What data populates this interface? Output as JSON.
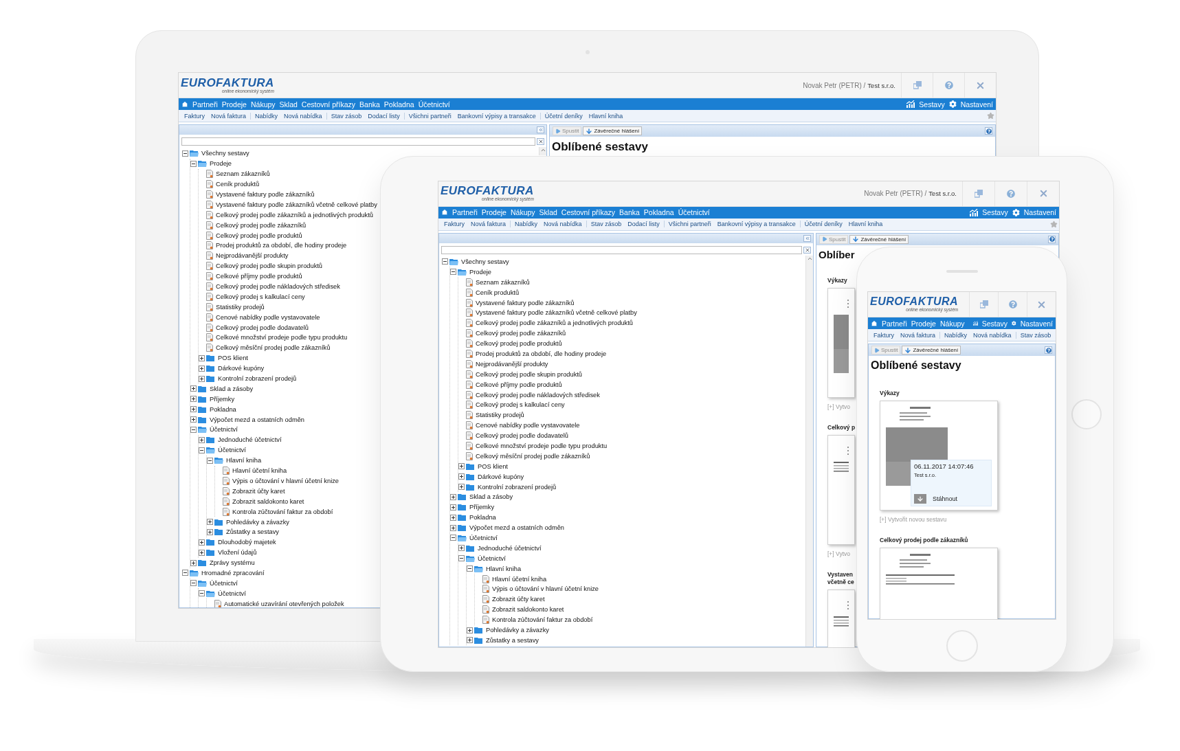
{
  "laptop": {
    "logo": {
      "wordmark": "EUROFAKTURA",
      "tagline": "online ekonomický systém"
    },
    "user": {
      "name": "Novak Petr (PETR) /",
      "company": "Test s.r.o."
    },
    "menu": [
      "Partneři",
      "Prodeje",
      "Nákupy",
      "Sklad",
      "Cestovní příkazy",
      "Banka",
      "Pokladna",
      "Účetnictví"
    ],
    "menu_right": [
      {
        "label": "Sestavy",
        "kind": "reports"
      },
      {
        "label": "Nastavení",
        "kind": "settings"
      }
    ],
    "toolbar_groups": [
      [
        "Faktury",
        "Nová faktura"
      ],
      [
        "Nabídky",
        "Nová nabídka"
      ],
      [
        "Stav zásob",
        "Dodací listy"
      ],
      [
        "Všichni partneři",
        "Bankovní výpisy a transakce"
      ],
      [
        "Účetní deníky",
        "Hlavní kniha"
      ]
    ],
    "actions": [
      {
        "label": "Spustit",
        "disabled": true
      },
      {
        "label": "Závěrečné hlášení",
        "disabled": false
      }
    ],
    "title": "Oblíbené sestavy",
    "tree": [
      {
        "label": "Všechny sestavy",
        "kind": "folder",
        "expanded": true,
        "children": [
          {
            "label": "Prodeje",
            "kind": "folder",
            "expanded": true,
            "children": [
              {
                "label": "Seznam zákazníků",
                "kind": "report"
              },
              {
                "label": "Ceník produktů",
                "kind": "report"
              },
              {
                "label": "Vystavené faktury podle zákazníků",
                "kind": "report"
              },
              {
                "label": "Vystavené faktury podle zákazníků včetně celkové platby",
                "kind": "report"
              },
              {
                "label": "Celkový prodej podle zákazníků a jednotlivých produktů",
                "kind": "report"
              },
              {
                "label": "Celkový prodej podle zákazníků",
                "kind": "report"
              },
              {
                "label": "Celkový prodej podle produktů",
                "kind": "report"
              },
              {
                "label": "Prodej produktů za období, dle hodiny prodeje",
                "kind": "report"
              },
              {
                "label": "Nejprodávanější produkty",
                "kind": "report"
              },
              {
                "label": "Celkový prodej podle skupin produktů",
                "kind": "report"
              },
              {
                "label": "Celkové příjmy podle produktů",
                "kind": "report"
              },
              {
                "label": "Celkový prodej podle nákladových středisek",
                "kind": "report"
              },
              {
                "label": "Celkový prodej s kalkulací ceny",
                "kind": "report"
              },
              {
                "label": "Statistiky prodejů",
                "kind": "report"
              },
              {
                "label": "Cenové nabídky podle vystavovatele",
                "kind": "report"
              },
              {
                "label": "Celkový prodej podle dodavatelů",
                "kind": "report"
              },
              {
                "label": "Celkové množství prodeje podle typu produktu",
                "kind": "report"
              },
              {
                "label": "Celkový měsíční prodej podle zákazníků",
                "kind": "report"
              },
              {
                "label": "POS klient",
                "kind": "folder",
                "expanded": false
              },
              {
                "label": "Dárkové kupóny",
                "kind": "folder",
                "expanded": false
              },
              {
                "label": "Kontrolní zobrazení prodejů",
                "kind": "folder",
                "expanded": false
              }
            ]
          },
          {
            "label": "Sklad a zásoby",
            "kind": "folder",
            "expanded": false
          },
          {
            "label": "Příjemky",
            "kind": "folder",
            "expanded": false
          },
          {
            "label": "Pokladna",
            "kind": "folder",
            "expanded": false
          },
          {
            "label": "Výpočet mezd a ostatních odměn",
            "kind": "folder",
            "expanded": false
          },
          {
            "label": "Účetnictví",
            "kind": "folder",
            "expanded": true,
            "children": [
              {
                "label": "Jednoduché účetnictví",
                "kind": "folder",
                "expanded": false
              },
              {
                "label": "Účetnictví",
                "kind": "folder",
                "expanded": true,
                "children": [
                  {
                    "label": "Hlavní kniha",
                    "kind": "folder",
                    "expanded": true,
                    "children": [
                      {
                        "label": "Hlavní účetní kniha",
                        "kind": "report"
                      },
                      {
                        "label": "Výpis o účtování v hlavní účetní knize",
                        "kind": "report"
                      },
                      {
                        "label": "Zobrazit účty karet",
                        "kind": "report"
                      },
                      {
                        "label": "Zobrazit saldokonto karet",
                        "kind": "report"
                      },
                      {
                        "label": "Kontrola zúčtování faktur za období",
                        "kind": "report"
                      }
                    ]
                  },
                  {
                    "label": "Pohledávky a závazky",
                    "kind": "folder",
                    "expanded": false
                  },
                  {
                    "label": "Zůstatky a sestavy",
                    "kind": "folder",
                    "expanded": false
                  }
                ]
              },
              {
                "label": "Dlouhodobý majetek",
                "kind": "folder",
                "expanded": false
              },
              {
                "label": "Vložení údajů",
                "kind": "folder",
                "expanded": false
              }
            ]
          },
          {
            "label": "Zprávy systému",
            "kind": "folder",
            "expanded": false
          }
        ]
      },
      {
        "label": "Hromadné zpracování",
        "kind": "folder",
        "expanded": true,
        "children": [
          {
            "label": "Účetnictví",
            "kind": "folder",
            "expanded": true,
            "children": [
              {
                "label": "Účetnictví",
                "kind": "folder",
                "expanded": true,
                "children": [
                  {
                    "label": "Automatické uzavírání otevřených položek",
                    "kind": "report"
                  }
                ]
              }
            ]
          }
        ]
      }
    ]
  },
  "tablet": {
    "logo": {
      "wordmark": "EUROFAKTURA",
      "tagline": "online ekonomický systém"
    },
    "user": {
      "name": "Novak Petr (PETR) /",
      "company": "Test s.r.o."
    },
    "menu": [
      "Partneři",
      "Prodeje",
      "Nákupy",
      "Sklad",
      "Cestovní příkazy",
      "Banka",
      "Pokladna",
      "Účetnictví"
    ],
    "menu_right": [
      {
        "label": "Sestavy",
        "kind": "reports"
      },
      {
        "label": "Nastavení",
        "kind": "settings"
      }
    ],
    "toolbar_groups": [
      [
        "Faktury",
        "Nová faktura"
      ],
      [
        "Nabídky",
        "Nová nabídka"
      ],
      [
        "Stav zásob",
        "Dodací listy"
      ],
      [
        "Všichni partneři",
        "Bankovní výpisy a transakce"
      ],
      [
        "Účetní deníky",
        "Hlavní kniha"
      ]
    ],
    "actions": [
      {
        "label": "Spustit",
        "disabled": true
      },
      {
        "label": "Závěrečné hlášení",
        "disabled": false
      }
    ],
    "title": "Oblíber",
    "sections": [
      {
        "title_lines": [
          "Výkazy"
        ],
        "create": "[+] Vytvo"
      },
      {
        "title_lines": [
          "Celkový p"
        ],
        "create": "[+] Vytvo"
      },
      {
        "title_lines": [
          "Vystaven",
          "včetně ce"
        ]
      }
    ],
    "tree": [
      {
        "label": "Všechny sestavy",
        "kind": "folder",
        "expanded": true,
        "children": [
          {
            "label": "Prodeje",
            "kind": "folder",
            "expanded": true,
            "children": [
              {
                "label": "Seznam zákazníků",
                "kind": "report"
              },
              {
                "label": "Ceník produktů",
                "kind": "report"
              },
              {
                "label": "Vystavené faktury podle zákazníků",
                "kind": "report"
              },
              {
                "label": "Vystavené faktury podle zákazníků včetně celkové platby",
                "kind": "report"
              },
              {
                "label": "Celkový prodej podle zákazníků a jednotlivých produktů",
                "kind": "report"
              },
              {
                "label": "Celkový prodej podle zákazníků",
                "kind": "report"
              },
              {
                "label": "Celkový prodej podle produktů",
                "kind": "report"
              },
              {
                "label": "Prodej produktů za období, dle hodiny prodeje",
                "kind": "report"
              },
              {
                "label": "Nejprodávanější produkty",
                "kind": "report"
              },
              {
                "label": "Celkový prodej podle skupin produktů",
                "kind": "report"
              },
              {
                "label": "Celkové příjmy podle produktů",
                "kind": "report"
              },
              {
                "label": "Celkový prodej podle nákladových středisek",
                "kind": "report"
              },
              {
                "label": "Celkový prodej s kalkulací ceny",
                "kind": "report"
              },
              {
                "label": "Statistiky prodejů",
                "kind": "report"
              },
              {
                "label": "Cenové nabídky podle vystavovatele",
                "kind": "report"
              },
              {
                "label": "Celkový prodej podle dodavatelů",
                "kind": "report"
              },
              {
                "label": "Celkové množství prodeje podle typu produktu",
                "kind": "report"
              },
              {
                "label": "Celkový měsíční prodej podle zákazníků",
                "kind": "report"
              },
              {
                "label": "POS klient",
                "kind": "folder",
                "expanded": false
              },
              {
                "label": "Dárkové kupóny",
                "kind": "folder",
                "expanded": false
              },
              {
                "label": "Kontrolní zobrazení prodejů",
                "kind": "folder",
                "expanded": false
              }
            ]
          },
          {
            "label": "Sklad a zásoby",
            "kind": "folder",
            "expanded": false
          },
          {
            "label": "Příjemky",
            "kind": "folder",
            "expanded": false
          },
          {
            "label": "Pokladna",
            "kind": "folder",
            "expanded": false
          },
          {
            "label": "Výpočet mezd a ostatních odměn",
            "kind": "folder",
            "expanded": false
          },
          {
            "label": "Účetnictví",
            "kind": "folder",
            "expanded": true,
            "children": [
              {
                "label": "Jednoduché účetnictví",
                "kind": "folder",
                "expanded": false
              },
              {
                "label": "Účetnictví",
                "kind": "folder",
                "expanded": true,
                "children": [
                  {
                    "label": "Hlavní kniha",
                    "kind": "folder",
                    "expanded": true,
                    "children": [
                      {
                        "label": "Hlavní účetní kniha",
                        "kind": "report"
                      },
                      {
                        "label": "Výpis o účtování v hlavní účetní knize",
                        "kind": "report"
                      },
                      {
                        "label": "Zobrazit účty karet",
                        "kind": "report"
                      },
                      {
                        "label": "Zobrazit saldokonto karet",
                        "kind": "report"
                      },
                      {
                        "label": "Kontrola zúčtování faktur za období",
                        "kind": "report"
                      }
                    ]
                  },
                  {
                    "label": "Pohledávky a závazky",
                    "kind": "folder",
                    "expanded": false
                  },
                  {
                    "label": "Zůstatky a sestavy",
                    "kind": "folder",
                    "expanded": false
                  }
                ]
              }
            ]
          }
        ]
      }
    ]
  },
  "phone": {
    "logo": {
      "wordmark": "EUROFAKTURA",
      "tagline": "online ekonomický systém"
    },
    "menu": [
      "Partneři",
      "Prodeje",
      "Nákupy"
    ],
    "menu_right": [
      {
        "label": "Sestavy",
        "kind": "reports"
      },
      {
        "label": "Nastavení",
        "kind": "settings"
      }
    ],
    "toolbar_groups": [
      [
        "Faktury",
        "Nová faktura"
      ],
      [
        "Nabídky",
        "Nová nabídka"
      ],
      [
        "Stav zásob"
      ]
    ],
    "actions": [
      {
        "label": "Spustit",
        "disabled": true
      },
      {
        "label": "Závěrečné hlášení",
        "disabled": false
      }
    ],
    "title": "Oblíbené sestavy",
    "sections": [
      {
        "title_lines": [
          "Výkazy"
        ],
        "card": {
          "date": "06.11.2017 14:07:46",
          "company": "Test s.r.o.",
          "download": "Stáhnout"
        },
        "create": "[+] Vytvořit novou sestavu"
      },
      {
        "title_lines": [
          "Celkový prodej podle zákazníků"
        ]
      }
    ]
  }
}
